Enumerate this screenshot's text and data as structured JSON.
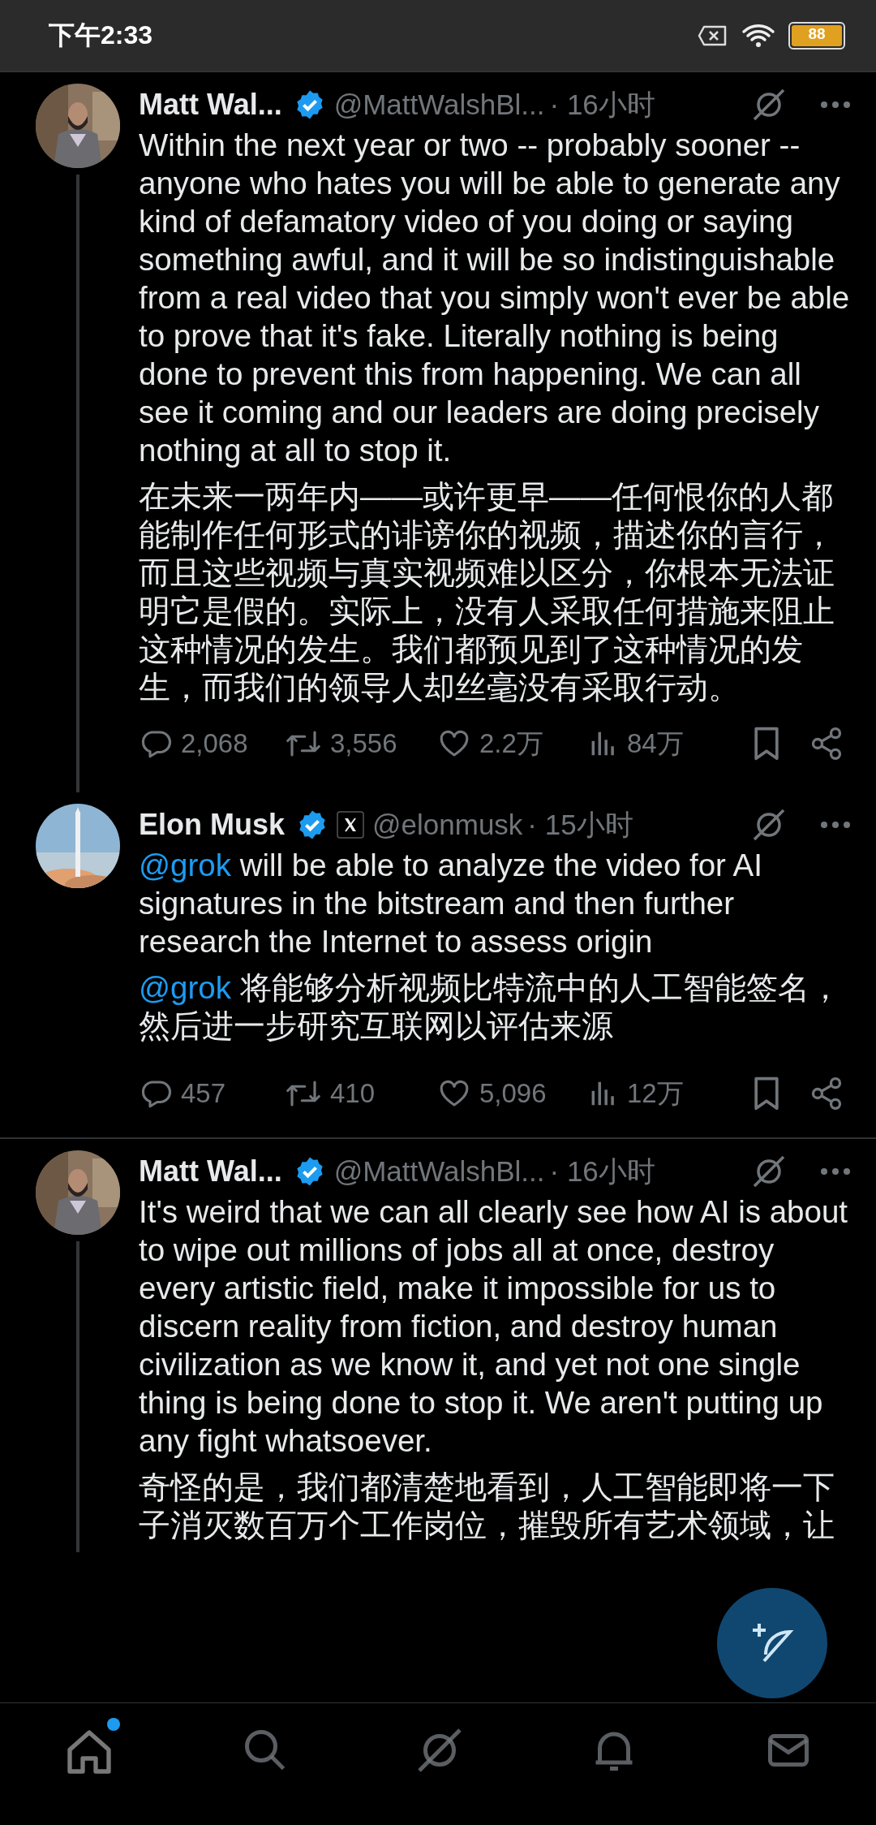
{
  "status_bar": {
    "time": "下午2:33",
    "battery": "88"
  },
  "tweets": [
    {
      "name": "Matt Wal...",
      "verified": true,
      "affiliate": false,
      "handle": "@MattWalshBl...",
      "time": "· 16小时",
      "thread_below": true,
      "divider_below": false,
      "paragraphs": [
        {
          "text": "Within the next year or two -- probably sooner -- anyone who hates you will be able to generate any kind of defamatory video of you doing or saying something awful, and it will be so indistinguishable from a real video that you simply won't ever be able to prove that it's fake. Literally nothing is being done to prevent this from happening. We can all see it coming and our leaders are doing precisely nothing at all to stop it."
        },
        {
          "text": "在未来一两年内——或许更早——任何恨你的人都能制作任何形式的诽谤你的视频，描述你的言行，而且这些视频与真实视频难以区分，你根本无法证明它是假的。实际上，没有人采取任何措施来阻止这种情况的发生。我们都预见到了这种情况的发生，而我们的领导人却丝毫没有采取行动。"
        }
      ],
      "stats": {
        "replies": "2,068",
        "reposts": "3,556",
        "likes": "2.2万",
        "views": "84万"
      }
    },
    {
      "name": "Elon Musk",
      "verified": true,
      "affiliate": true,
      "handle": "@elonmusk",
      "time": "· 15小时",
      "thread_below": false,
      "divider_below": true,
      "paragraphs": [
        {
          "mention": "@grok",
          "text": " will be able to analyze the video for AI signatures in the bitstream and then further research the Internet to assess origin"
        },
        {
          "mention": "@grok",
          "text": " 将能够分析视频比特流中的人工智能签名，然后进一步研究互联网以评估来源"
        }
      ],
      "stats": {
        "replies": "457",
        "reposts": "410",
        "likes": "5,096",
        "views": "12万"
      }
    },
    {
      "name": "Matt Wal...",
      "verified": true,
      "affiliate": false,
      "handle": "@MattWalshBl...",
      "time": "· 16小时",
      "thread_below": true,
      "divider_below": false,
      "paragraphs": [
        {
          "text": "It's weird that we can all clearly see how AI is about to wipe out millions of jobs all at once, destroy every artistic field, make it impossible for us to discern reality from fiction, and destroy human civilization as we know it, and yet not one single thing is being done to stop it. We aren't putting up any fight whatsoever."
        },
        {
          "text": "奇怪的是，我们都清楚地看到，人工智能即将一下子消灭数百万个工作岗位，摧毁所有艺术领域，让"
        }
      ]
    }
  ],
  "bottom_nav": [
    {
      "kind": "home",
      "selected": true,
      "dot": true
    },
    {
      "kind": "search",
      "selected": false,
      "dot": false
    },
    {
      "kind": "grok",
      "selected": false,
      "dot": false
    },
    {
      "kind": "bell",
      "selected": false,
      "dot": false
    },
    {
      "kind": "mail",
      "selected": false,
      "dot": false
    }
  ]
}
